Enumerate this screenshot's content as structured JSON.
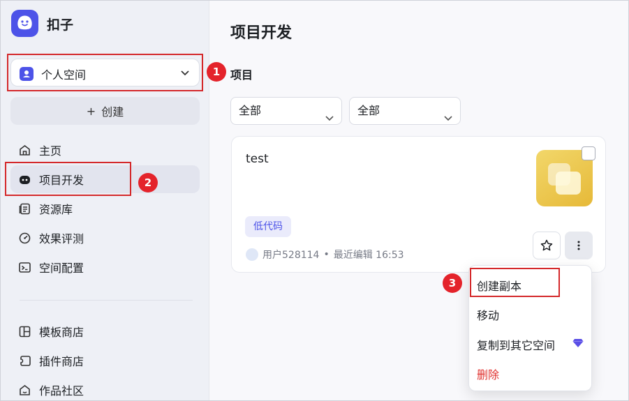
{
  "brand": {
    "name": "扣子"
  },
  "sidebar": {
    "space_selector": "个人空间",
    "create_button": "创建",
    "create_plus": "+",
    "items": [
      {
        "label": "主页",
        "icon": "home-icon"
      },
      {
        "label": "项目开发",
        "icon": "robot-icon",
        "active": true
      },
      {
        "label": "资源库",
        "icon": "library-icon"
      },
      {
        "label": "效果评测",
        "icon": "gauge-icon"
      },
      {
        "label": "空间配置",
        "icon": "terminal-icon"
      },
      {
        "label": "模板商店",
        "icon": "template-icon"
      },
      {
        "label": "插件商店",
        "icon": "plugin-icon"
      },
      {
        "label": "作品社区",
        "icon": "community-icon"
      }
    ]
  },
  "main": {
    "title": "项目开发",
    "section_title": "项目",
    "filters": [
      "全部",
      "全部"
    ]
  },
  "card": {
    "name": "test",
    "tag": "低代码",
    "user": "用户528114",
    "separator": "•",
    "edited": "最近编辑 16:53"
  },
  "menu": {
    "items": [
      "创建副本",
      "移动",
      "复制到其它空间",
      "删除"
    ]
  },
  "annotations": [
    "1",
    "2",
    "3"
  ],
  "colors": {
    "accent": "#4d53e8",
    "danger": "#e0322f",
    "annotation": "#e4232b",
    "thumb": "#edc84f"
  }
}
